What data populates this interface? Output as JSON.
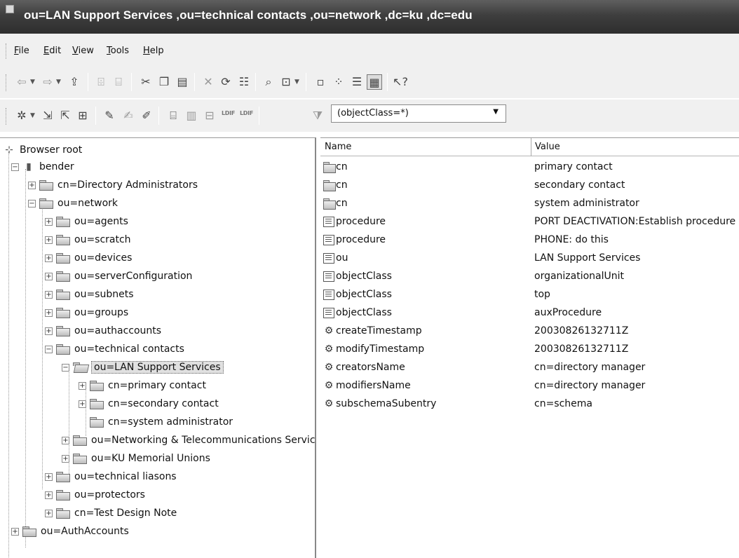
{
  "window": {
    "title": "ou=LAN Support Services ,ou=technical contacts ,ou=network ,dc=ku ,dc=edu"
  },
  "menu": [
    "File",
    "Edit",
    "View",
    "Tools",
    "Help"
  ],
  "toolbar2": {
    "ldif_import": "LDIF",
    "ldif_export": "LDIF",
    "filter_value": "(objectClass=*)"
  },
  "tree": {
    "root": "Browser root",
    "nodes": [
      "bender",
      "cn=Directory Administrators",
      "ou=network",
      "ou=agents",
      "ou=scratch",
      "ou=devices",
      "ou=serverConfiguration",
      "ou=subnets",
      "ou=groups",
      "ou=authaccounts",
      "ou=technical contacts",
      "ou=LAN Support Services",
      "cn=primary contact",
      "cn=secondary contact",
      "cn=system administrator",
      "ou=Networking & Telecommunications Services",
      "ou=KU Memorial Unions",
      "ou=technical liasons",
      "ou=protectors",
      "cn=Test Design Note",
      "ou=AuthAccounts"
    ]
  },
  "list": {
    "columns": [
      "Name",
      "Value"
    ],
    "rows": [
      {
        "icon": "folder-icon",
        "name": "cn",
        "value": "primary contact"
      },
      {
        "icon": "folder-icon",
        "name": "cn",
        "value": "secondary contact"
      },
      {
        "icon": "folder-icon",
        "name": "cn",
        "value": "system administrator"
      },
      {
        "icon": "attribute-icon",
        "name": "procedure",
        "value": "PORT DEACTIVATION:Establish procedure"
      },
      {
        "icon": "attribute-icon",
        "name": "procedure",
        "value": "PHONE: do this"
      },
      {
        "icon": "attribute-icon",
        "name": "ou",
        "value": "LAN Support Services"
      },
      {
        "icon": "attribute-icon",
        "name": "objectClass",
        "value": "organizationalUnit"
      },
      {
        "icon": "attribute-icon",
        "name": "objectClass",
        "value": "top"
      },
      {
        "icon": "attribute-icon",
        "name": "objectClass",
        "value": "auxProcedure"
      },
      {
        "icon": "operational-attribute-icon",
        "name": "createTimestamp",
        "value": "20030826132711Z"
      },
      {
        "icon": "operational-attribute-icon",
        "name": "modifyTimestamp",
        "value": "20030826132711Z"
      },
      {
        "icon": "operational-attribute-icon",
        "name": "creatorsName",
        "value": "cn=directory manager"
      },
      {
        "icon": "operational-attribute-icon",
        "name": "modifiersName",
        "value": "cn=directory manager"
      },
      {
        "icon": "operational-attribute-icon",
        "name": "subschemaSubentry",
        "value": "cn=schema"
      }
    ]
  }
}
